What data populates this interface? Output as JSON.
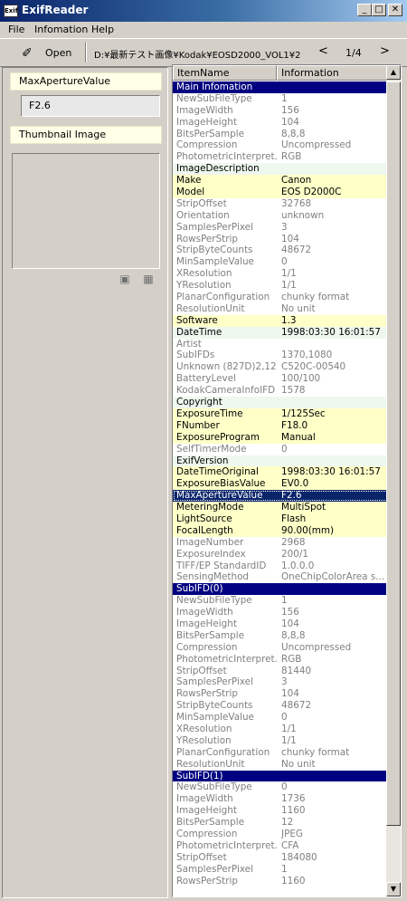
{
  "window": {
    "title": "ExifReader",
    "icon_text": "Exif"
  },
  "menu": [
    "File",
    "Infomation",
    "Help"
  ],
  "toolbar": {
    "open_label": "Open",
    "path": "D:¥最新テスト画像¥Kodak¥EOSD2000_VOL1¥2",
    "page": "1/4",
    "prev": "<",
    "next": ">"
  },
  "left": {
    "field_label": "MaxApertureValue",
    "field_value": "F2.6",
    "thumbnail_label": "Thumbnail Image"
  },
  "list": {
    "headers": [
      "ItemName",
      "Information"
    ],
    "rows": [
      {
        "n": "Main Infomation",
        "v": "",
        "t": "section"
      },
      {
        "n": "NewSubFileType",
        "v": "1",
        "t": "dim"
      },
      {
        "n": "ImageWidth",
        "v": "156",
        "t": "dim"
      },
      {
        "n": "ImageHeight",
        "v": "104",
        "t": "dim"
      },
      {
        "n": "BitsPerSample",
        "v": "8,8,8",
        "t": "dim"
      },
      {
        "n": "Compression",
        "v": "Uncompressed",
        "t": "dim"
      },
      {
        "n": "PhotometricInterpret...",
        "v": "RGB",
        "t": "dim"
      },
      {
        "n": "ImageDescription",
        "v": "",
        "t": "green"
      },
      {
        "n": "Make",
        "v": "Canon",
        "t": "highlight"
      },
      {
        "n": "Model",
        "v": "EOS D2000C",
        "t": "highlight"
      },
      {
        "n": "StripOffset",
        "v": "32768",
        "t": "dim"
      },
      {
        "n": "Orientation",
        "v": "unknown",
        "t": "dim"
      },
      {
        "n": "SamplesPerPixel",
        "v": "3",
        "t": "dim"
      },
      {
        "n": "RowsPerStrip",
        "v": "104",
        "t": "dim"
      },
      {
        "n": "StripByteCounts",
        "v": "48672",
        "t": "dim"
      },
      {
        "n": "MinSampleValue",
        "v": "0",
        "t": "dim"
      },
      {
        "n": "XResolution",
        "v": "1/1",
        "t": "dim"
      },
      {
        "n": "YResolution",
        "v": "1/1",
        "t": "dim"
      },
      {
        "n": "PlanarConfiguration",
        "v": "chunky format",
        "t": "dim"
      },
      {
        "n": "ResolutionUnit",
        "v": "No unit",
        "t": "dim"
      },
      {
        "n": "Software",
        "v": "1.3",
        "t": "highlight"
      },
      {
        "n": "DateTime",
        "v": "1998:03:30 16:01:57",
        "t": "green"
      },
      {
        "n": "Artist",
        "v": "",
        "t": "dim"
      },
      {
        "n": "SubIFDs",
        "v": "1370,1080",
        "t": "dim"
      },
      {
        "n": "Unknown (827D)2,12",
        "v": "C520C-00540",
        "t": "dim"
      },
      {
        "n": "BatteryLevel",
        "v": "100/100",
        "t": "dim"
      },
      {
        "n": "KodakCameraInfoIFD",
        "v": "1578",
        "t": "dim"
      },
      {
        "n": "Copyright",
        "v": "",
        "t": "green"
      },
      {
        "n": "ExposureTime",
        "v": "1/125Sec",
        "t": "highlight"
      },
      {
        "n": "FNumber",
        "v": "F18.0",
        "t": "highlight"
      },
      {
        "n": "ExposureProgram",
        "v": "Manual",
        "t": "highlight"
      },
      {
        "n": "SelfTimerMode",
        "v": "0",
        "t": "dim"
      },
      {
        "n": "ExifVersion",
        "v": "",
        "t": "green"
      },
      {
        "n": "DateTimeOriginal",
        "v": "1998:03:30 16:01:57",
        "t": "highlight"
      },
      {
        "n": "ExposureBiasValue",
        "v": "EV0.0",
        "t": "highlight"
      },
      {
        "n": "MaxApertureValue",
        "v": "F2.6",
        "t": "selected"
      },
      {
        "n": "MeteringMode",
        "v": "MultiSpot",
        "t": "highlight"
      },
      {
        "n": "LightSource",
        "v": "Flash",
        "t": "highlight"
      },
      {
        "n": "FocalLength",
        "v": "90.00(mm)",
        "t": "highlight"
      },
      {
        "n": "ImageNumber",
        "v": "2968",
        "t": "dim"
      },
      {
        "n": "ExposureIndex",
        "v": "200/1",
        "t": "dim"
      },
      {
        "n": "TIFF/EP StandardID",
        "v": "1.0.0.0",
        "t": "dim"
      },
      {
        "n": "SensingMethod",
        "v": "OneChipColorArea s...",
        "t": "dim"
      },
      {
        "n": "SubIFD(0)",
        "v": "",
        "t": "section"
      },
      {
        "n": "NewSubFileType",
        "v": "1",
        "t": "dim"
      },
      {
        "n": "ImageWidth",
        "v": "156",
        "t": "dim"
      },
      {
        "n": "ImageHeight",
        "v": "104",
        "t": "dim"
      },
      {
        "n": "BitsPerSample",
        "v": "8,8,8",
        "t": "dim"
      },
      {
        "n": "Compression",
        "v": "Uncompressed",
        "t": "dim"
      },
      {
        "n": "PhotometricInterpret...",
        "v": "RGB",
        "t": "dim"
      },
      {
        "n": "StripOffset",
        "v": "81440",
        "t": "dim"
      },
      {
        "n": "SamplesPerPixel",
        "v": "3",
        "t": "dim"
      },
      {
        "n": "RowsPerStrip",
        "v": "104",
        "t": "dim"
      },
      {
        "n": "StripByteCounts",
        "v": "48672",
        "t": "dim"
      },
      {
        "n": "MinSampleValue",
        "v": "0",
        "t": "dim"
      },
      {
        "n": "XResolution",
        "v": "1/1",
        "t": "dim"
      },
      {
        "n": "YResolution",
        "v": "1/1",
        "t": "dim"
      },
      {
        "n": "PlanarConfiguration",
        "v": "chunky format",
        "t": "dim"
      },
      {
        "n": "ResolutionUnit",
        "v": "No unit",
        "t": "dim"
      },
      {
        "n": "SubIFD(1)",
        "v": "",
        "t": "section"
      },
      {
        "n": "NewSubFileType",
        "v": "0",
        "t": "dim"
      },
      {
        "n": "ImageWidth",
        "v": "1736",
        "t": "dim"
      },
      {
        "n": "ImageHeight",
        "v": "1160",
        "t": "dim"
      },
      {
        "n": "BitsPerSample",
        "v": "12",
        "t": "dim"
      },
      {
        "n": "Compression",
        "v": "JPEG",
        "t": "dim"
      },
      {
        "n": "PhotometricInterpret...",
        "v": "CFA",
        "t": "dim"
      },
      {
        "n": "StripOffset",
        "v": "184080",
        "t": "dim"
      },
      {
        "n": "SamplesPerPixel",
        "v": "1",
        "t": "dim"
      },
      {
        "n": "RowsPerStrip",
        "v": "1160",
        "t": "dim"
      }
    ]
  },
  "colors": {
    "section_bg": "#000080",
    "highlight_bg": "#ffffc8",
    "green_bg": "#eef8ee",
    "selected_bg": "#0a246a",
    "dim_text": "#808080"
  },
  "icons": [
    "save-icon",
    "copy-icon",
    "minimize-icon",
    "maximize-icon",
    "close-icon",
    "open-icon",
    "scroll-up-icon",
    "scroll-down-icon"
  ]
}
